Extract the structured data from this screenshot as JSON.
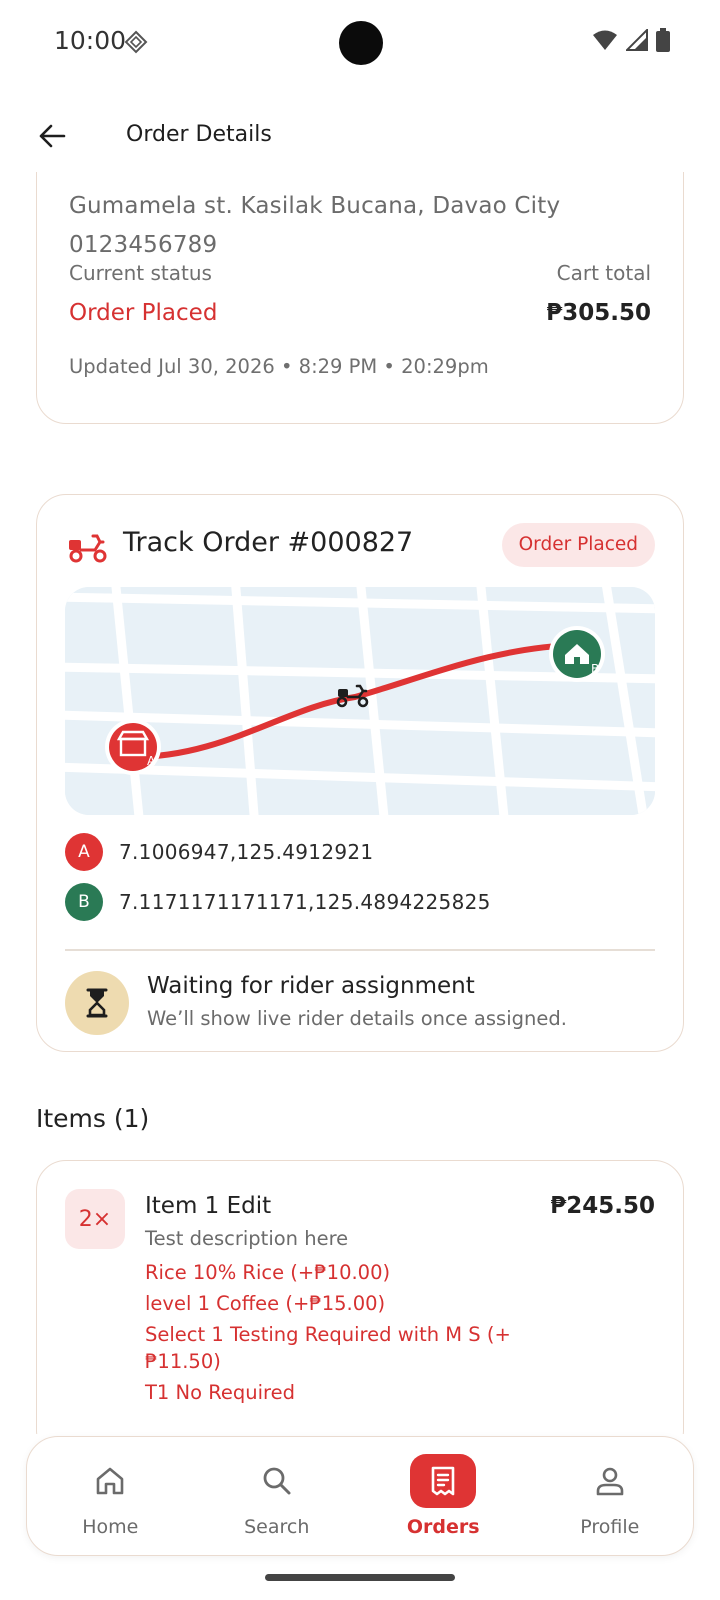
{
  "status_bar": {
    "time": "10:00"
  },
  "app_bar": {
    "title": "Order Details"
  },
  "order_info": {
    "address": "Gumamela st. Kasilak Bucana, Davao City",
    "phone": "0123456789",
    "current_status_label": "Current status",
    "current_status": "Order Placed",
    "cart_total_label": "Cart total",
    "cart_total": "₱305.50",
    "updated": "Updated Jul 30, 2026 • 8:29 PM • 20:29pm"
  },
  "tracking": {
    "title": "Track Order #000827",
    "badge": "Order Placed",
    "point_a_label": "A",
    "point_a_coords": "7.1006947,125.4912921",
    "point_b_label": "B",
    "point_b_coords": "7.1171171171171,125.4894225825",
    "waiting_title": "Waiting for rider assignment",
    "waiting_subtitle": "We’ll show live rider details once assigned.",
    "colors": {
      "accent": "#df3434",
      "destination": "#2a7a55",
      "map_bg": "#e8f1f7"
    }
  },
  "items": {
    "heading": "Items (1)",
    "list": [
      {
        "qty": "2×",
        "name": "Item 1 Edit",
        "price": "₱245.50",
        "description": "Test description here",
        "options": [
          "Rice 10% Rice (+₱10.00)",
          "level 1 Coffee (+₱15.00)",
          "Select 1 Testing Required with M S (+₱11.50)",
          "T1 No Required"
        ]
      }
    ]
  },
  "bottom_nav": {
    "items": [
      {
        "label": "Home",
        "icon": "home-icon",
        "active": false
      },
      {
        "label": "Search",
        "icon": "search-icon",
        "active": false
      },
      {
        "label": "Orders",
        "icon": "receipt-icon",
        "active": true
      },
      {
        "label": "Profile",
        "icon": "person-icon",
        "active": false
      }
    ]
  }
}
